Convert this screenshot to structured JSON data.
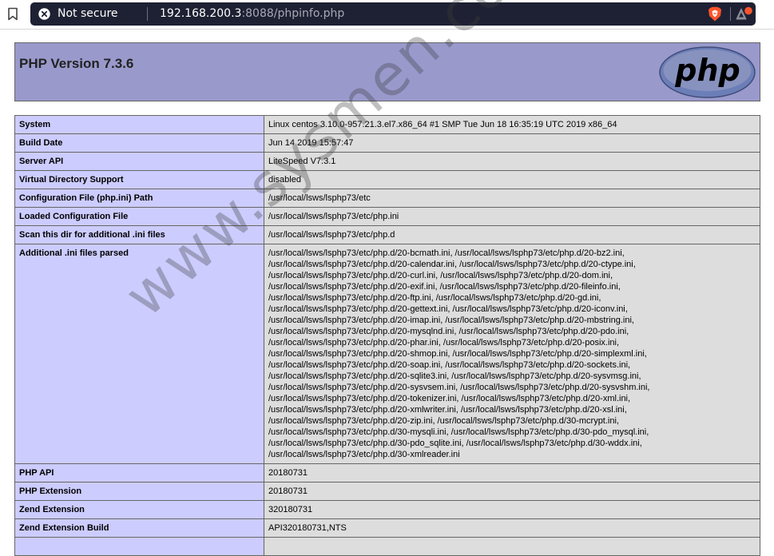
{
  "browser": {
    "security_label": "Not secure",
    "url_host": "192.168.200.3",
    "url_rest": ":8088/phpinfo.php",
    "icons": [
      "bookmark-icon",
      "not-secure-icon",
      "brave-shields-icon",
      "brave-rewards-icon"
    ],
    "colors": {
      "urlbar_bg": "#1e2133",
      "brave_orange": "#fb542b"
    }
  },
  "phpinfo": {
    "title": "PHP Version 7.3.6",
    "logo_text": "php",
    "colors": {
      "header_bg": "#9999cc",
      "key_bg": "#ccccff",
      "value_bg": "#dddddd"
    },
    "rows": [
      {
        "key": "System",
        "value": "Linux centos 3.10.0-957.21.3.el7.x86_64 #1 SMP Tue Jun 18 16:35:19 UTC 2019 x86_64"
      },
      {
        "key": "Build Date",
        "value": "Jun 14 2019 15:57:47"
      },
      {
        "key": "Server API",
        "value": "LiteSpeed V7.3.1"
      },
      {
        "key": "Virtual Directory Support",
        "value": "disabled"
      },
      {
        "key": "Configuration File (php.ini) Path",
        "value": "/usr/local/lsws/lsphp73/etc"
      },
      {
        "key": "Loaded Configuration File",
        "value": "/usr/local/lsws/lsphp73/etc/php.ini"
      },
      {
        "key": "Scan this dir for additional .ini files",
        "value": "/usr/local/lsws/lsphp73/etc/php.d"
      },
      {
        "key": "Additional .ini files parsed",
        "lines": [
          "/usr/local/lsws/lsphp73/etc/php.d/20-bcmath.ini, /usr/local/lsws/lsphp73/etc/php.d/20-bz2.ini,",
          "/usr/local/lsws/lsphp73/etc/php.d/20-calendar.ini, /usr/local/lsws/lsphp73/etc/php.d/20-ctype.ini,",
          "/usr/local/lsws/lsphp73/etc/php.d/20-curl.ini, /usr/local/lsws/lsphp73/etc/php.d/20-dom.ini,",
          "/usr/local/lsws/lsphp73/etc/php.d/20-exif.ini, /usr/local/lsws/lsphp73/etc/php.d/20-fileinfo.ini,",
          "/usr/local/lsws/lsphp73/etc/php.d/20-ftp.ini, /usr/local/lsws/lsphp73/etc/php.d/20-gd.ini,",
          "/usr/local/lsws/lsphp73/etc/php.d/20-gettext.ini, /usr/local/lsws/lsphp73/etc/php.d/20-iconv.ini,",
          "/usr/local/lsws/lsphp73/etc/php.d/20-imap.ini, /usr/local/lsws/lsphp73/etc/php.d/20-mbstring.ini,",
          "/usr/local/lsws/lsphp73/etc/php.d/20-mysqlnd.ini, /usr/local/lsws/lsphp73/etc/php.d/20-pdo.ini,",
          "/usr/local/lsws/lsphp73/etc/php.d/20-phar.ini, /usr/local/lsws/lsphp73/etc/php.d/20-posix.ini,",
          "/usr/local/lsws/lsphp73/etc/php.d/20-shmop.ini, /usr/local/lsws/lsphp73/etc/php.d/20-simplexml.ini,",
          "/usr/local/lsws/lsphp73/etc/php.d/20-soap.ini, /usr/local/lsws/lsphp73/etc/php.d/20-sockets.ini,",
          "/usr/local/lsws/lsphp73/etc/php.d/20-sqlite3.ini, /usr/local/lsws/lsphp73/etc/php.d/20-sysvmsg.ini,",
          "/usr/local/lsws/lsphp73/etc/php.d/20-sysvsem.ini, /usr/local/lsws/lsphp73/etc/php.d/20-sysvshm.ini,",
          "/usr/local/lsws/lsphp73/etc/php.d/20-tokenizer.ini, /usr/local/lsws/lsphp73/etc/php.d/20-xml.ini,",
          "/usr/local/lsws/lsphp73/etc/php.d/20-xmlwriter.ini, /usr/local/lsws/lsphp73/etc/php.d/20-xsl.ini,",
          "/usr/local/lsws/lsphp73/etc/php.d/20-zip.ini, /usr/local/lsws/lsphp73/etc/php.d/30-mcrypt.ini,",
          "/usr/local/lsws/lsphp73/etc/php.d/30-mysqli.ini, /usr/local/lsws/lsphp73/etc/php.d/30-pdo_mysql.ini,",
          "/usr/local/lsws/lsphp73/etc/php.d/30-pdo_sqlite.ini, /usr/local/lsws/lsphp73/etc/php.d/30-wddx.ini,",
          "/usr/local/lsws/lsphp73/etc/php.d/30-xmlreader.ini"
        ]
      },
      {
        "key": "PHP API",
        "value": "20180731"
      },
      {
        "key": "PHP Extension",
        "value": "20180731"
      },
      {
        "key": "Zend Extension",
        "value": "320180731"
      },
      {
        "key": "Zend Extension Build",
        "value": "API320180731,NTS"
      },
      {
        "key": "",
        "value": ""
      }
    ]
  },
  "watermark": "www.sysmen.com"
}
